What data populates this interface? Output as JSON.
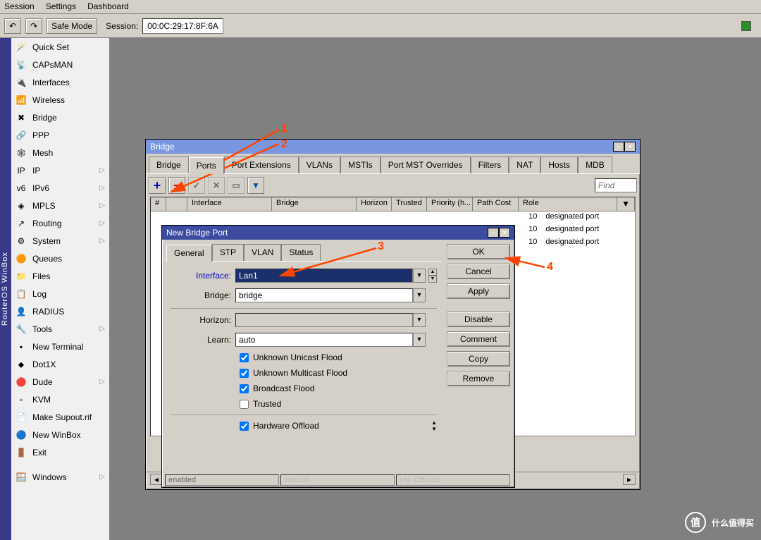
{
  "menubar": [
    "Session",
    "Settings",
    "Dashboard"
  ],
  "toolbar": {
    "safe_mode": "Safe Mode",
    "session_label": "Session:",
    "session_value": "00:0C:29:17:8F:6A"
  },
  "vert_label": "RouterOS WinBox",
  "sidebar": [
    {
      "icon": "🪄",
      "label": "Quick Set"
    },
    {
      "icon": "📡",
      "label": "CAPsMAN"
    },
    {
      "icon": "🔌",
      "label": "Interfaces"
    },
    {
      "icon": "📶",
      "label": "Wireless"
    },
    {
      "icon": "✖",
      "label": "Bridge"
    },
    {
      "icon": "🔗",
      "label": "PPP"
    },
    {
      "icon": "🕸",
      "label": "Mesh"
    },
    {
      "icon": "IP",
      "label": "IP",
      "sub": true
    },
    {
      "icon": "v6",
      "label": "IPv6",
      "sub": true
    },
    {
      "icon": "◈",
      "label": "MPLS",
      "sub": true
    },
    {
      "icon": "↗",
      "label": "Routing",
      "sub": true
    },
    {
      "icon": "⚙",
      "label": "System",
      "sub": true
    },
    {
      "icon": "🟠",
      "label": "Queues"
    },
    {
      "icon": "📁",
      "label": "Files"
    },
    {
      "icon": "📋",
      "label": "Log"
    },
    {
      "icon": "👤",
      "label": "RADIUS"
    },
    {
      "icon": "🔧",
      "label": "Tools",
      "sub": true
    },
    {
      "icon": "▪",
      "label": "New Terminal"
    },
    {
      "icon": "⬥",
      "label": "Dot1X"
    },
    {
      "icon": "🔴",
      "label": "Dude",
      "sub": true
    },
    {
      "icon": "▫",
      "label": "KVM"
    },
    {
      "icon": "📄",
      "label": "Make Supout.rif"
    },
    {
      "icon": "🔵",
      "label": "New WinBox"
    },
    {
      "icon": "🚪",
      "label": "Exit"
    },
    {
      "icon": "",
      "label": ""
    },
    {
      "icon": "🪟",
      "label": "Windows",
      "sub": true
    }
  ],
  "bridge_win": {
    "title": "Bridge",
    "tabs": [
      "Bridge",
      "Ports",
      "Port Extensions",
      "VLANs",
      "MSTIs",
      "Port MST Overrides",
      "Filters",
      "NAT",
      "Hosts",
      "MDB"
    ],
    "active_tab": 1,
    "find": "Find",
    "columns": [
      "#",
      "",
      "Interface",
      "Bridge",
      "Horizon",
      "Trusted",
      "Priority (h...",
      "Path Cost",
      "Role"
    ],
    "rows": [
      {
        "pc": "10",
        "role": "designated port"
      },
      {
        "pc": "10",
        "role": "designated port"
      },
      {
        "pc": "10",
        "role": "designated port"
      }
    ],
    "status": {
      "count": "3",
      "enabled": "enabled",
      "inactive": "inactive",
      "hw": "Hw. Offload"
    }
  },
  "dialog": {
    "title": "New Bridge Port",
    "tabs": [
      "General",
      "STP",
      "VLAN",
      "Status"
    ],
    "fields": {
      "interface_label": "Interface:",
      "interface_value": "Lan1",
      "bridge_label": "Bridge:",
      "bridge_value": "bridge",
      "horizon_label": "Horizon:",
      "horizon_value": "",
      "learn_label": "Learn:",
      "learn_value": "auto"
    },
    "checks": {
      "uuf": "Unknown Unicast Flood",
      "umf": "Unknown Multicast Flood",
      "bf": "Broadcast Flood",
      "trusted": "Trusted",
      "hw": "Hardware Offload"
    },
    "buttons": {
      "ok": "OK",
      "cancel": "Cancel",
      "apply": "Apply",
      "disable": "Disable",
      "comment": "Comment",
      "copy": "Copy",
      "remove": "Remove"
    }
  },
  "annotations": {
    "a1": "1",
    "a2": "2",
    "a3": "3",
    "a4": "4"
  },
  "watermark": "什么值得买"
}
